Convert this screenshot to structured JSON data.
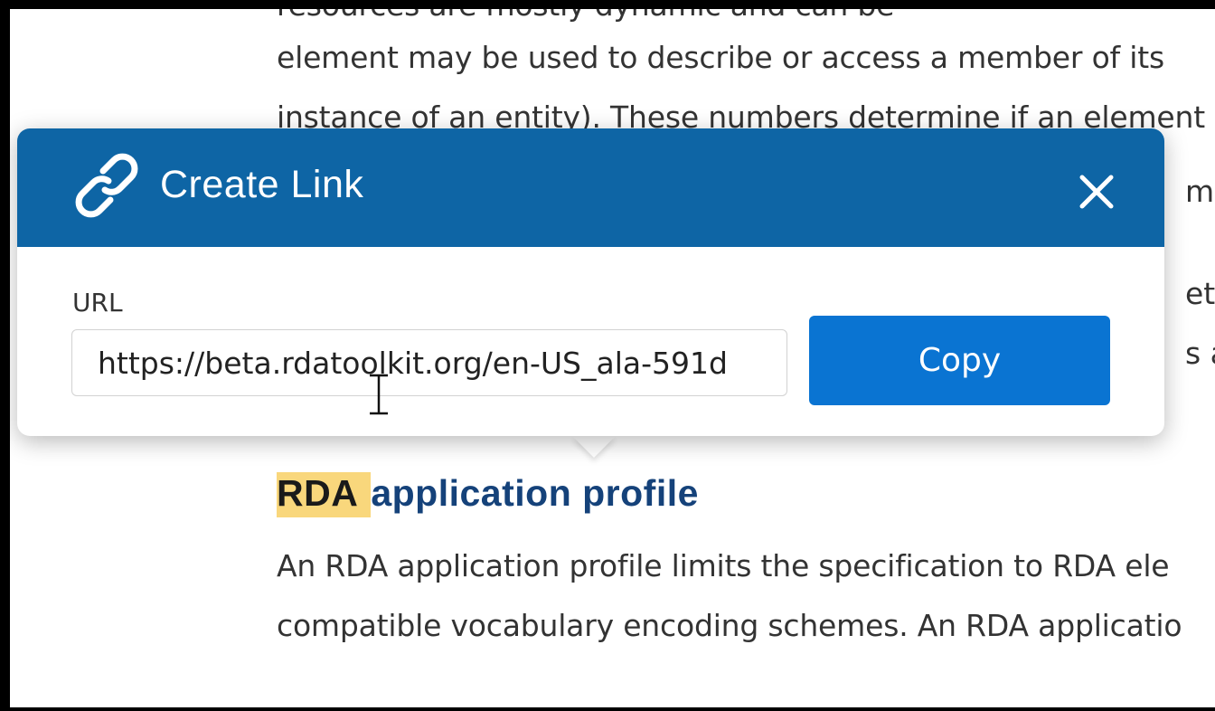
{
  "background": {
    "partial_top_line": "resources are mostly dynamic and can be",
    "line_1": "element may be used to describe or access a member of its",
    "line_2": "instance of an entity). These numbers determine if an element",
    "side_fragments": [
      "max",
      "etac",
      "s ar"
    ]
  },
  "section": {
    "heading_highlight": "RDA",
    "heading_rest": "application profile",
    "paragraph_line_1": "An RDA application profile limits the specification to RDA ele",
    "paragraph_line_2": "compatible vocabulary encoding schemes. An RDA applicatio"
  },
  "dialog": {
    "title": "Create Link",
    "icon": "link-icon",
    "close_icon": "close-icon",
    "url_label": "URL",
    "url_value": "https://beta.rdatoolkit.org/en-US_ala-591d",
    "copy_label": "Copy"
  },
  "colors": {
    "header_bg": "#0e65a5",
    "copy_button_bg": "#0a74d2",
    "heading_text": "#15427a",
    "highlight": "#f9d77c"
  }
}
